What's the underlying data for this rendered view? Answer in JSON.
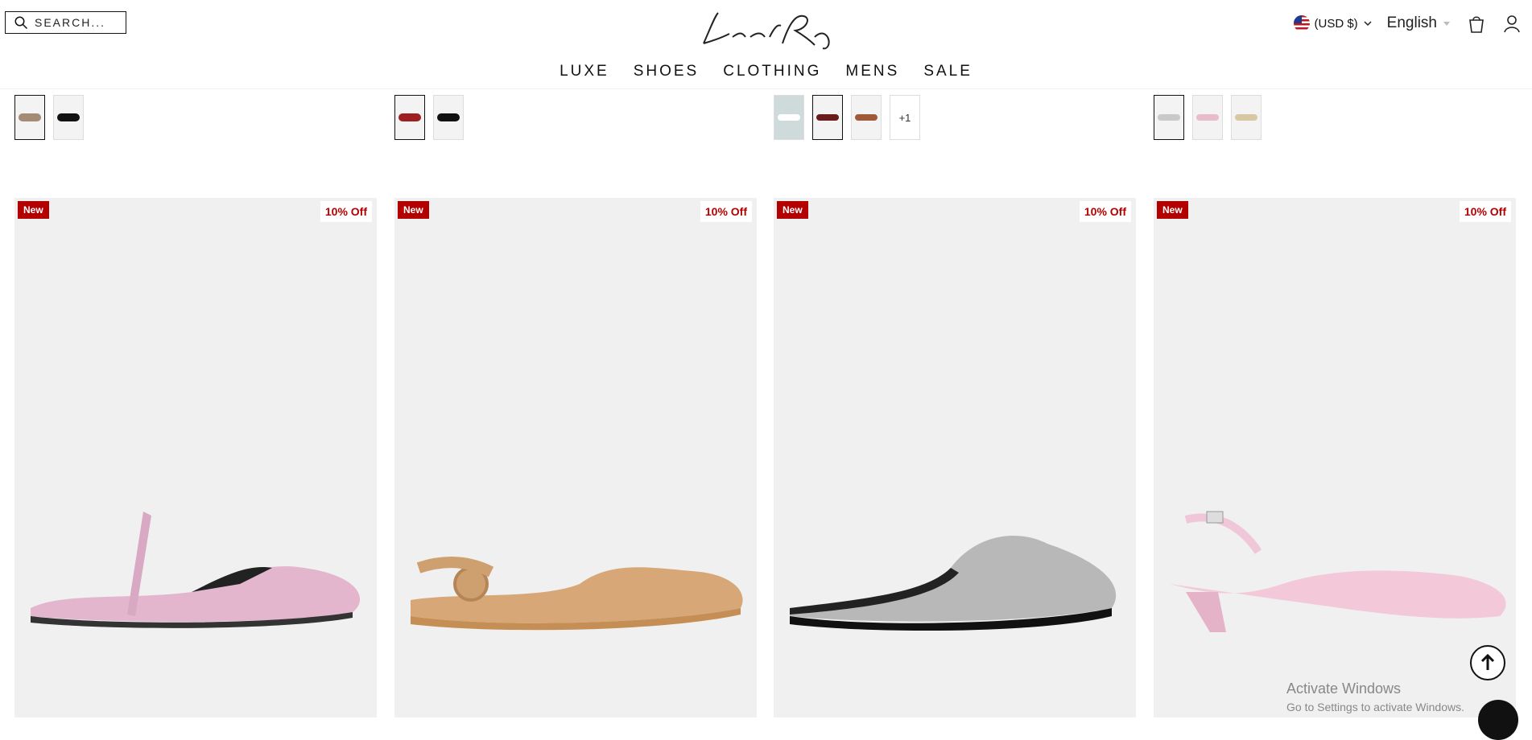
{
  "header": {
    "search_placeholder": "SEARCH...",
    "currency": "(USD $)",
    "language": "English",
    "logo_text": "London Rag"
  },
  "nav": [
    "LUXE",
    "SHOES",
    "CLOTHING",
    "MENS",
    "SALE"
  ],
  "swatch_groups": [
    {
      "count": 2,
      "more": ""
    },
    {
      "count": 2,
      "more": ""
    },
    {
      "count": 3,
      "more": "+1"
    },
    {
      "count": 3,
      "more": ""
    }
  ],
  "products": [
    {
      "badge_new": "New",
      "badge_off": "10% Off",
      "color": "#e7b9d2"
    },
    {
      "badge_new": "New",
      "badge_off": "10% Off",
      "color": "#d8a777"
    },
    {
      "badge_new": "New",
      "badge_off": "10% Off",
      "color": "#b8b8b8"
    },
    {
      "badge_new": "New",
      "badge_off": "10% Off",
      "color": "#f0c7d8"
    }
  ],
  "overlay": {
    "activate_title": "Activate Windows",
    "activate_sub": "Go to Settings to activate Windows."
  },
  "colors": {
    "badge_red": "#b30000",
    "card_bg": "#f0f0f0"
  }
}
